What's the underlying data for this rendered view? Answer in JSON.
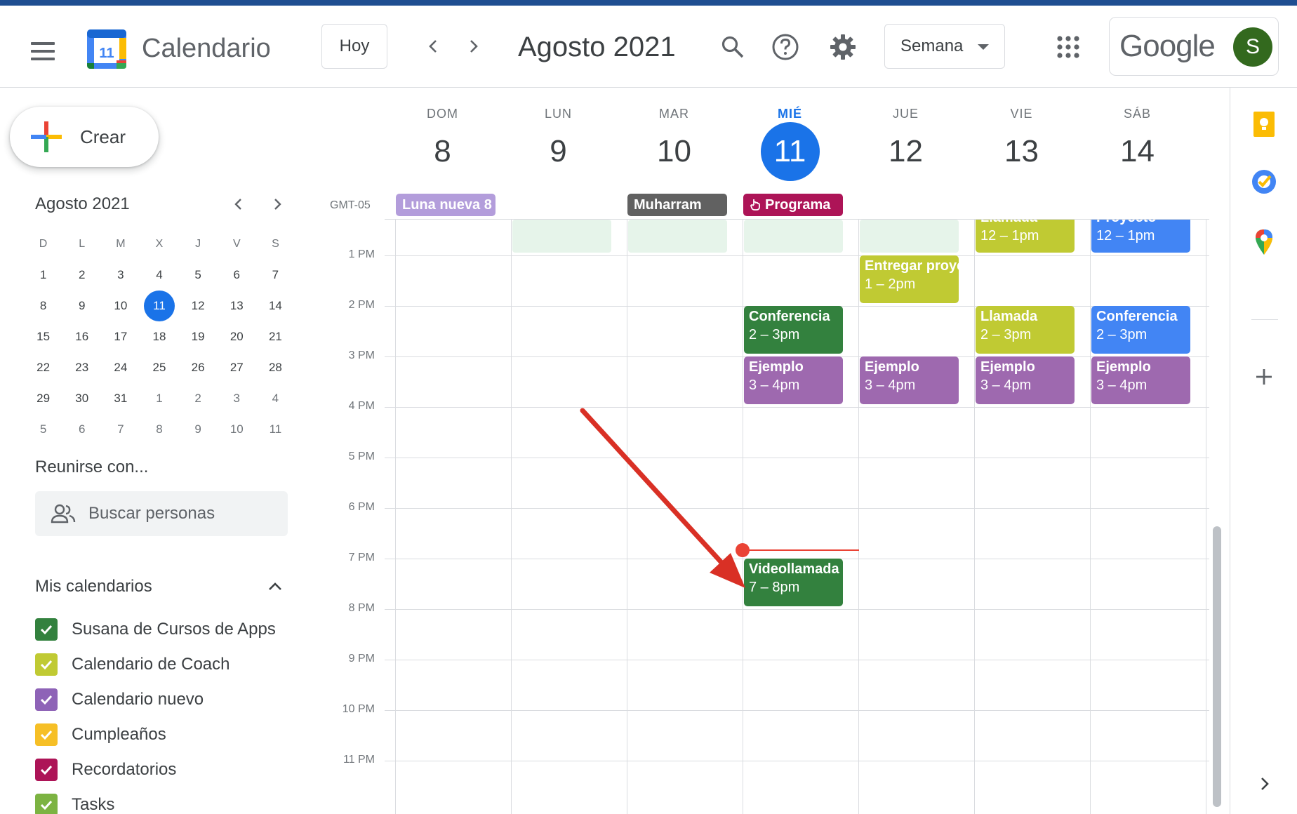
{
  "header": {
    "app_title": "Calendario",
    "logo_day": "11",
    "today_button": "Hoy",
    "period": "Agosto 2021",
    "view_select": "Semana",
    "account_brand": "Google",
    "avatar_letter": "S"
  },
  "sidebar": {
    "create_label": "Crear",
    "mini_calendar": {
      "title": "Agosto 2021",
      "weekday_headers": [
        "D",
        "L",
        "M",
        "X",
        "J",
        "V",
        "S"
      ],
      "weeks": [
        [
          "1",
          "2",
          "3",
          "4",
          "5",
          "6",
          "7"
        ],
        [
          "8",
          "9",
          "10",
          "11",
          "12",
          "13",
          "14"
        ],
        [
          "15",
          "16",
          "17",
          "18",
          "19",
          "20",
          "21"
        ],
        [
          "22",
          "23",
          "24",
          "25",
          "26",
          "27",
          "28"
        ],
        [
          "29",
          "30",
          "31",
          "1",
          "2",
          "3",
          "4"
        ],
        [
          "5",
          "6",
          "7",
          "8",
          "9",
          "10",
          "11"
        ]
      ],
      "today": "11"
    },
    "meet_title": "Reunirse con...",
    "people_search_placeholder": "Buscar personas",
    "my_calendars_title": "Mis calendarios",
    "calendars": [
      {
        "name": "Susana de Cursos de Apps",
        "color": "#33813e"
      },
      {
        "name": "Calendario de Coach",
        "color": "#c0ca33"
      },
      {
        "name": "Calendario nuevo",
        "color": "#8e63b7"
      },
      {
        "name": "Cumpleaños",
        "color": "#f6bf26"
      },
      {
        "name": "Recordatorios",
        "color": "#ad1457"
      },
      {
        "name": "Tasks",
        "color": "#7cb342"
      }
    ]
  },
  "week": {
    "timezone": "GMT-05",
    "days": [
      {
        "name": "DOM",
        "num": "8"
      },
      {
        "name": "LUN",
        "num": "9"
      },
      {
        "name": "MAR",
        "num": "10"
      },
      {
        "name": "MIÉ",
        "num": "11",
        "today": true
      },
      {
        "name": "JUE",
        "num": "12"
      },
      {
        "name": "VIE",
        "num": "13"
      },
      {
        "name": "SÁB",
        "num": "14"
      }
    ],
    "all_day": [
      {
        "title": "Luna nueva 8",
        "day": 0,
        "color": "#b39ddb"
      },
      {
        "title": "Muharram",
        "day": 2,
        "color": "#616161"
      },
      {
        "title": "Programa",
        "day": 3,
        "color": "#ad1457",
        "icon": "hand-icon"
      }
    ],
    "hours": [
      "1 PM",
      "2 PM",
      "3 PM",
      "4 PM",
      "5 PM",
      "6 PM",
      "7 PM",
      "8 PM",
      "9 PM",
      "10 PM",
      "11 PM"
    ],
    "events": [
      {
        "title": "Llamada",
        "time": "12 – 1pm",
        "day": 5,
        "color": "#c0ca33",
        "partial": true
      },
      {
        "title": "Proyecto",
        "time": "12 – 1pm",
        "day": 6,
        "color": "#4285f4",
        "partial": true
      },
      {
        "title": "Entregar proyecto",
        "time": "1 – 2pm",
        "day": 4,
        "color": "#c0ca33"
      },
      {
        "title": "Conferencia",
        "time": "2 – 3pm",
        "day": 3,
        "color": "#33813e"
      },
      {
        "title": "Llamada",
        "time": "2 – 3pm",
        "day": 5,
        "color": "#c0ca33"
      },
      {
        "title": "Conferencia",
        "time": "2 – 3pm",
        "day": 6,
        "color": "#4285f4"
      },
      {
        "title": "Ejemplo",
        "time": "3 – 4pm",
        "day": 3,
        "color": "#9e69af"
      },
      {
        "title": "Ejemplo",
        "time": "3 – 4pm",
        "day": 4,
        "color": "#9e69af"
      },
      {
        "title": "Ejemplo",
        "time": "3 – 4pm",
        "day": 5,
        "color": "#9e69af"
      },
      {
        "title": "Ejemplo",
        "time": "3 – 4pm",
        "day": 6,
        "color": "#9e69af"
      },
      {
        "title": "Videollamada",
        "time": "7 – 8pm",
        "day": 3,
        "color": "#33813e"
      }
    ]
  },
  "right_rail": {
    "icons": [
      "keep-icon",
      "tasks-icon",
      "maps-icon",
      "add-icon",
      "expand-icon"
    ]
  },
  "colors": {
    "accent": "#1a73e8",
    "now_line": "#ea4335",
    "annotation_arrow": "#d93025"
  }
}
